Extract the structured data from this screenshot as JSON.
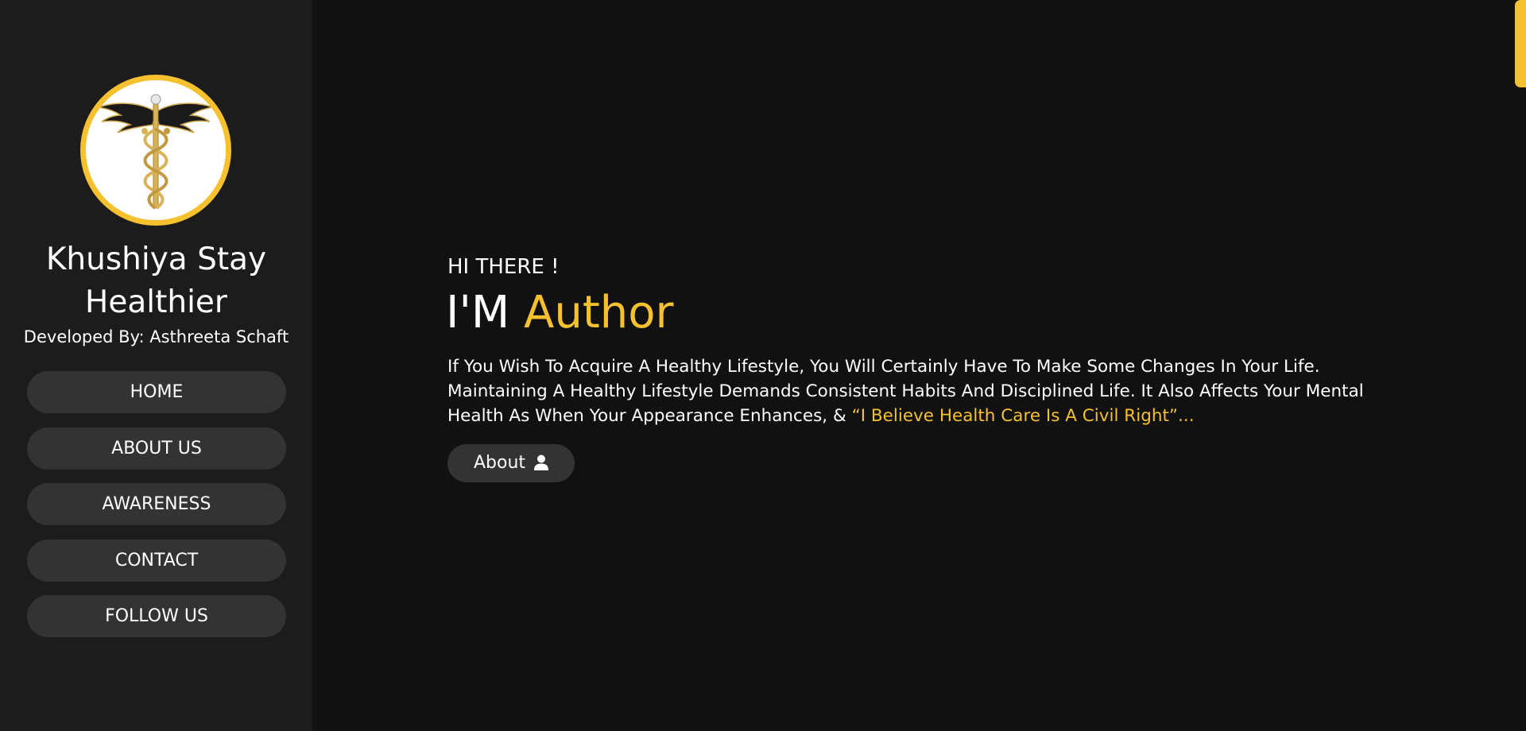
{
  "sidebar": {
    "site_title_line1": "Khushiya Stay",
    "site_title_line2": "Healthier",
    "developer": "Developed By: Asthreeta Schaft",
    "logo_icon": "caduceus-icon",
    "nav": [
      {
        "label": "HOME"
      },
      {
        "label": "ABOUT US"
      },
      {
        "label": "AWARENESS"
      },
      {
        "label": "CONTACT"
      },
      {
        "label": "FOLLOW US"
      }
    ]
  },
  "main": {
    "greeting": "HI THERE !",
    "headline_prefix": "I'M ",
    "headline_accent": "Author",
    "intro_text": "If You Wish To Acquire A Healthy Lifestyle, You Will Certainly Have To Make Some Changes In Your Life. Maintaining A Healthy Lifestyle Demands Consistent Habits And Disciplined Life. It Also Affects Your Mental Health As When Your Appearance Enhances, & ",
    "intro_quote": "“I Believe Health Care Is A Civil Right”...",
    "about_button_label": "About",
    "about_button_icon": "user-icon"
  },
  "colors": {
    "accent": "#f5c12e",
    "sidebar_bg": "#1c1c1c",
    "main_bg": "#111111",
    "button_bg": "#333333"
  }
}
